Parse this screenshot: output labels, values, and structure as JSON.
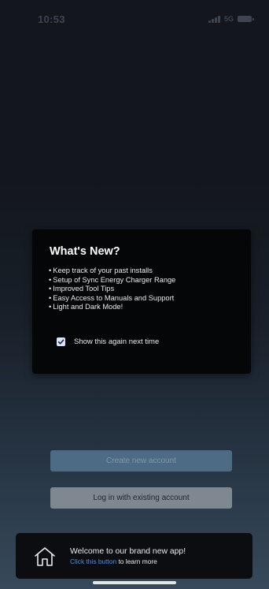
{
  "status_bar": {
    "time": "10:53",
    "network": "5G"
  },
  "whats_new": {
    "title": "What's New?",
    "features": [
      "Keep track of your past installs",
      "Setup of Sync Energy Charger Range",
      "Improved Tool Tips",
      "Easy Access to Manuals and Support",
      "Light and Dark Mode!"
    ],
    "checkbox_label": "Show this again next time",
    "checkbox_checked": true
  },
  "buttons": {
    "create_label": "Create new account",
    "login_label": "Log in with existing account"
  },
  "welcome": {
    "title": "Welcome to our brand new app!",
    "link_text": "Click this button",
    "rest_text": " to learn more",
    "icon": "home-icon"
  },
  "colors": {
    "modal_bg": "#050607",
    "create_button_bg": "#4e6b85",
    "login_button_bg": "#7f8790",
    "link": "#4a90e2",
    "checkbox": "#dbe4f5"
  }
}
